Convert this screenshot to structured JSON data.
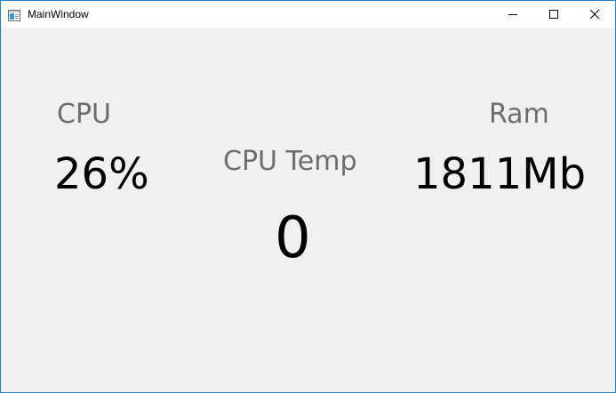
{
  "window": {
    "title": "MainWindow",
    "icon": "window-app-icon",
    "controls": [
      "minimize-icon",
      "maximize-icon",
      "close-icon"
    ]
  },
  "cpu": {
    "label": "CPU",
    "value": "26%"
  },
  "cpu_temp": {
    "label": "CPU Temp",
    "value": "0"
  },
  "ram": {
    "label": "Ram",
    "value": "1811Mb"
  },
  "colors": {
    "window_border": "#1883d7",
    "titlebar": "#ffffff",
    "client_background": "#f0f0f0",
    "label_text": "#6d6d6d",
    "value_text": "#000000"
  }
}
